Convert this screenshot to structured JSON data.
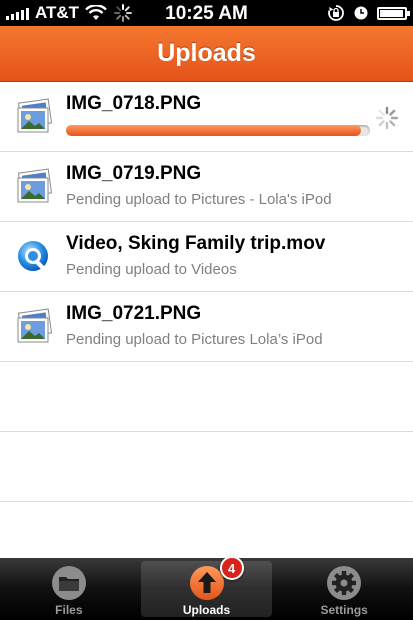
{
  "status_bar": {
    "carrier": "AT&T",
    "time": "10:25 AM",
    "icons": [
      "signal-icon",
      "wifi-icon",
      "activity-spinner-icon",
      "rotation-lock-icon",
      "alarm-clock-icon",
      "battery-icon"
    ]
  },
  "navbar": {
    "title": "Uploads"
  },
  "uploads": [
    {
      "name": "IMG_0718.PNG",
      "status": "",
      "icon": "image-file-icon",
      "progress": 0.97,
      "uploading": true
    },
    {
      "name": "IMG_0719.PNG",
      "status": "Pending upload to Pictures - Lola's iPod",
      "icon": "image-file-icon"
    },
    {
      "name": "Video, Sking Family trip.mov",
      "status": "Pending upload to Videos",
      "icon": "quicktime-icon"
    },
    {
      "name": "IMG_0721.PNG",
      "status": "Pending upload to Pictures Lola’s iPod",
      "icon": "image-file-icon"
    }
  ],
  "tabs": [
    {
      "label": "Files",
      "icon": "folder-icon"
    },
    {
      "label": "Uploads",
      "icon": "upload-arrow-icon",
      "badge": "4",
      "active": true
    },
    {
      "label": "Settings",
      "icon": "gear-icon"
    }
  ],
  "colors": {
    "accent": "#e4541a",
    "badge": "#d9221c"
  }
}
